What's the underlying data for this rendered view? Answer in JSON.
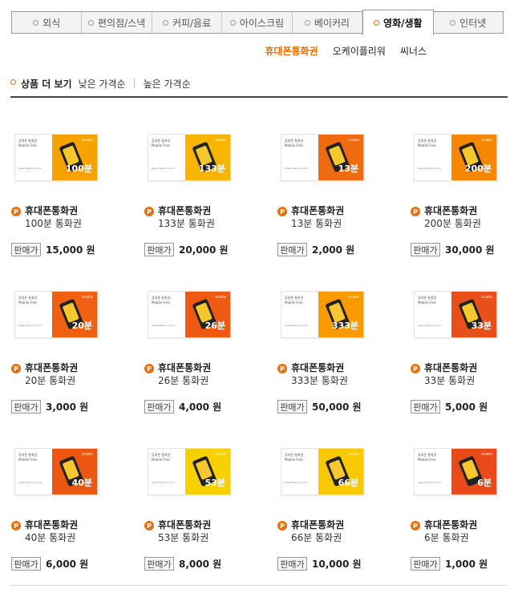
{
  "tabs": [
    {
      "label": "외식",
      "active": false
    },
    {
      "label": "편의점/스낵",
      "active": false
    },
    {
      "label": "커피/음료",
      "active": false
    },
    {
      "label": "아이스크림",
      "active": false
    },
    {
      "label": "베이커리",
      "active": false
    },
    {
      "label": "영화/생활",
      "active": true
    },
    {
      "label": "인터넷",
      "active": false
    }
  ],
  "subnav": [
    {
      "label": "휴대폰통화권",
      "active": true
    },
    {
      "label": "오케이플리워",
      "active": false
    },
    {
      "label": "씨너스",
      "active": false
    }
  ],
  "sortbar": {
    "title": "상품 더 보기",
    "low": "낮은 가격순",
    "high": "높은 가격순"
  },
  "card_text": {
    "name": "휴대폰 통화권",
    "sub": "Mobile Free",
    "url": "www.ktservice.com",
    "brand": "mobile"
  },
  "common": {
    "badge": "P",
    "price_label": "판매가",
    "product_name": "휴대폰통화권"
  },
  "products": [
    {
      "desc": "100분 통화권",
      "price": "15,000 원",
      "mins": "100분",
      "color": "#f6a300"
    },
    {
      "desc": "133분 통화권",
      "price": "20,000 원",
      "mins": "133분",
      "color": "#f7b500"
    },
    {
      "desc": "13분 통화권",
      "price": "2,000 원",
      "mins": "13분",
      "color": "#f06a10"
    },
    {
      "desc": "200분 통화권",
      "price": "30,000 원",
      "mins": "200분",
      "color": "#f58800"
    },
    {
      "desc": "20분 통화권",
      "price": "3,000 원",
      "mins": "20분",
      "color": "#ef6010"
    },
    {
      "desc": "26분 통화권",
      "price": "4,000 원",
      "mins": "26분",
      "color": "#ee5a12"
    },
    {
      "desc": "333분 통화권",
      "price": "50,000 원",
      "mins": "333분",
      "color": "#f89a00"
    },
    {
      "desc": "33분 통화권",
      "price": "5,000 원",
      "mins": "33분",
      "color": "#e8501a"
    },
    {
      "desc": "40분 통화권",
      "price": "6,000 원",
      "mins": "40분",
      "color": "#ec5812"
    },
    {
      "desc": "53분 통화권",
      "price": "8,000 원",
      "mins": "53분",
      "color": "#f6d000"
    },
    {
      "desc": "66분 통화권",
      "price": "10,000 원",
      "mins": "66분",
      "color": "#f8c800"
    },
    {
      "desc": "6분 통화권",
      "price": "1,000 원",
      "mins": "6분",
      "color": "#e84a1a"
    }
  ]
}
